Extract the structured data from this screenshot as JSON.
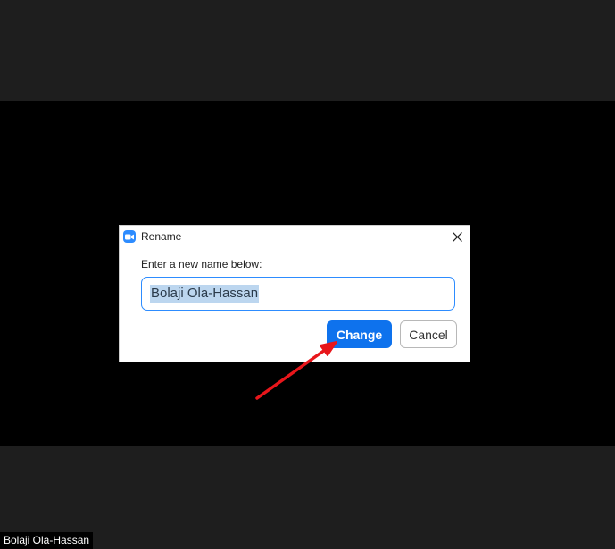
{
  "dialog": {
    "title": "Rename",
    "prompt": "Enter a new name below:",
    "input_value": "Bolaji Ola-Hassan",
    "change_label": "Change",
    "cancel_label": "Cancel",
    "close_icon": "close-icon",
    "app_icon": "zoom-camera-icon"
  },
  "participant": {
    "name_tag": "Bolaji Ola-Hassan"
  },
  "colors": {
    "accent": "#0e72ed",
    "brand": "#2d8cff",
    "annotation_arrow": "#e8161b",
    "selection": "#bcd6ef",
    "background": "#1e1e1e",
    "video": "#000000"
  }
}
